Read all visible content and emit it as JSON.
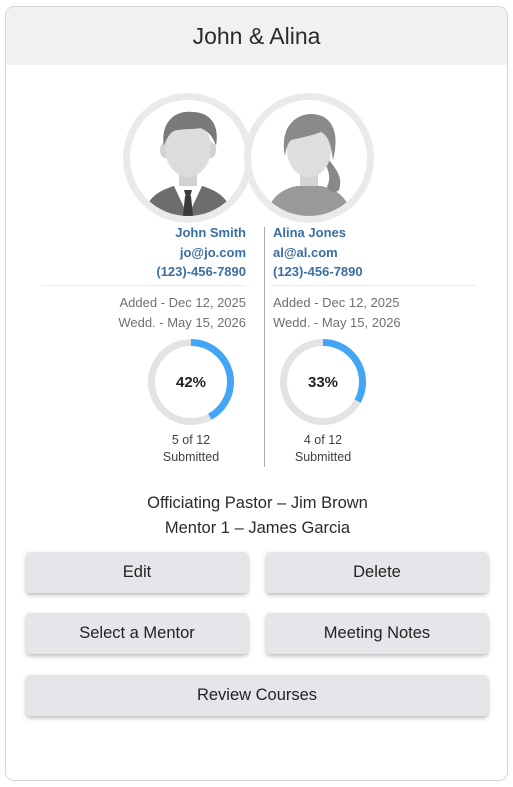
{
  "header": {
    "title": "John & Alina"
  },
  "partners": [
    {
      "name": "John Smith",
      "email": "jo@jo.com",
      "phone": "(123)-456-7890",
      "added": "Added - Dec 12, 2025",
      "wedding": "Wedd. - May 15, 2026",
      "progress": {
        "percent_label": "42%",
        "fraction": 0.42,
        "count_label": "5 of 12",
        "status_label": "Submitted"
      },
      "avatar_icon": "male-avatar-icon"
    },
    {
      "name": "Alina Jones",
      "email": "al@al.com",
      "phone": "(123)-456-7890",
      "added": "Added - Dec 12, 2025",
      "wedding": "Wedd. - May 15, 2026",
      "progress": {
        "percent_label": "33%",
        "fraction": 0.33,
        "count_label": "4 of 12",
        "status_label": "Submitted"
      },
      "avatar_icon": "female-avatar-icon"
    }
  ],
  "assignments": {
    "pastor": "Officiating Pastor – Jim Brown",
    "mentor": "Mentor 1 – James Garcia"
  },
  "buttons": {
    "edit": "Edit",
    "delete": "Delete",
    "select_mentor": "Select a Mentor",
    "meeting_notes": "Meeting Notes",
    "review_courses": "Review Courses"
  },
  "colors": {
    "progress": "#42a5f5",
    "ring_track": "#e3e3e3",
    "link": "#3a6ea5",
    "button_bg": "#e4e6e9"
  }
}
